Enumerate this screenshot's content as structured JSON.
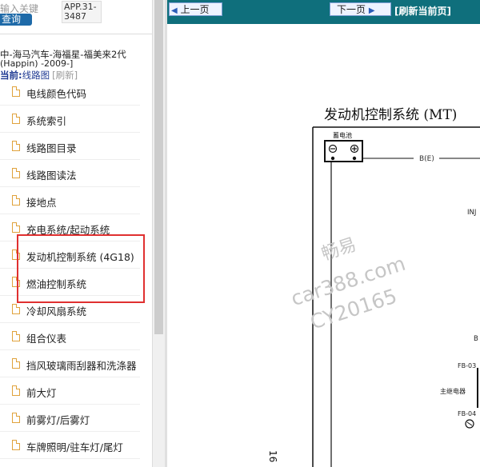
{
  "search": {
    "label_visible": "输入关键",
    "label_suffix": "…",
    "query_button": "查询",
    "app_no": "APP.31-3487"
  },
  "vehicle": {
    "title": "中-海马汽车-海福星-福美来2代",
    "subtitle": "(Happin) -2009-]"
  },
  "current": {
    "label": "当前:",
    "value": "线路图",
    "refresh": "[刷新]"
  },
  "menu": {
    "items": [
      {
        "label": "电线颜色代码"
      },
      {
        "label": "系统索引"
      },
      {
        "label": "线路图目录"
      },
      {
        "label": "线路图读法"
      },
      {
        "label": "接地点"
      },
      {
        "label": "充电系统/起动系统"
      },
      {
        "label": "发动机控制系统 (4G18)"
      },
      {
        "label": "燃油控制系统"
      },
      {
        "label": "冷却风扇系统"
      },
      {
        "label": "组合仪表"
      },
      {
        "label": "挡风玻璃雨刮器和洗涤器"
      },
      {
        "label": "前大灯"
      },
      {
        "label": "前雾灯/后雾灯"
      },
      {
        "label": "车牌照明/驻车灯/尾灯"
      }
    ]
  },
  "toolbar": {
    "prev": "上一页",
    "next": "下一页",
    "refresh": "[刷新当前页]"
  },
  "diagram": {
    "title": "发动机控制系统 (MT)",
    "battery_label": "蓄电池",
    "wire_label": "B(E)",
    "inj_label": "INJ",
    "fb03": "FB-03",
    "fb04": "FB-04",
    "relay_label": "主继电器",
    "b_label": "B",
    "page_no": "16",
    "watermark_cn": "畅易",
    "watermark_url": "car388.com",
    "watermark_code": "CY20165"
  },
  "colors": {
    "toolbar_bg": "#0f6f7c",
    "highlight": "#e03030",
    "query_bg": "#1e6aa8"
  }
}
